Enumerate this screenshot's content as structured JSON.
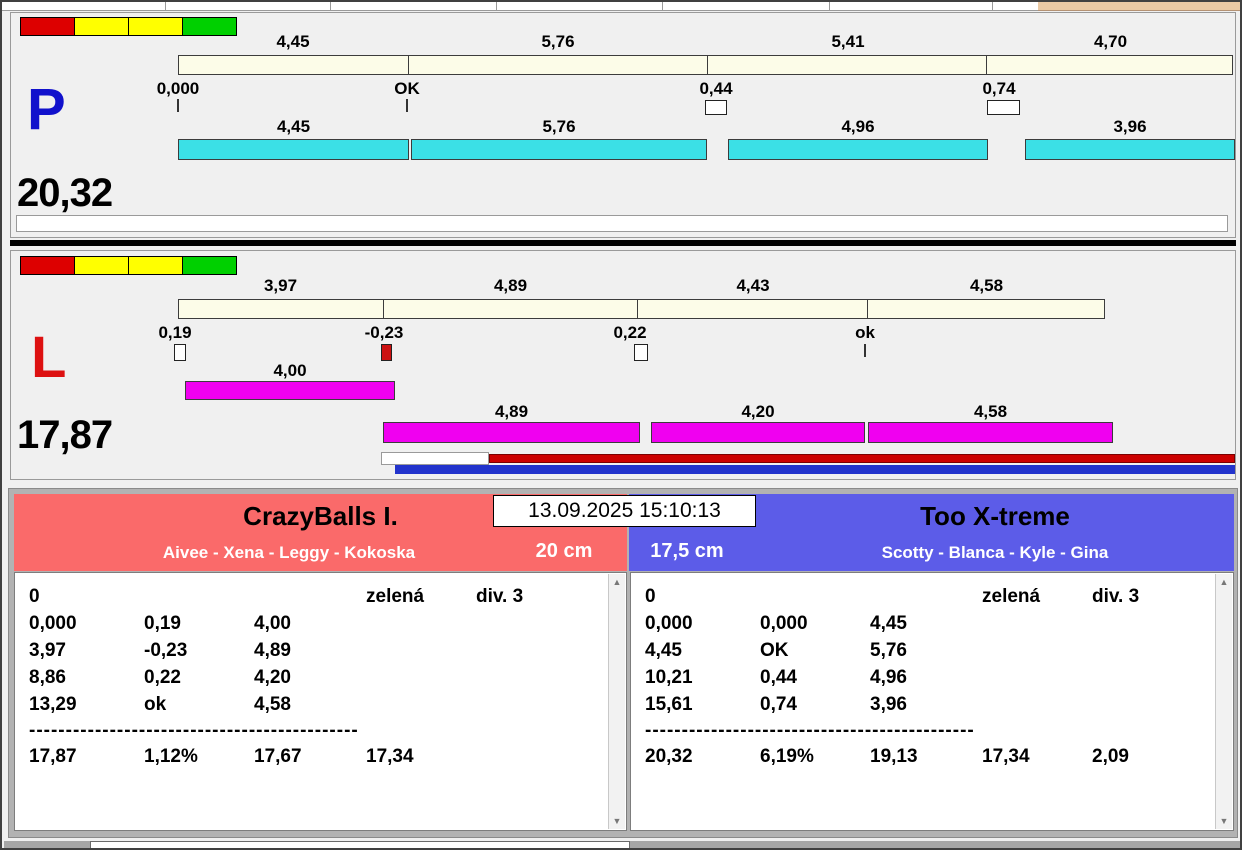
{
  "colors": {
    "cyan_bar": "#3be0e6",
    "magenta_bar": "#f000f0",
    "cream_bar": "#fcfce8",
    "team_left_bg": "#fa6a6a",
    "team_right_bg": "#5c5ce8",
    "p_letter_color": "#1111cc",
    "l_letter_color": "#dd1111",
    "status_red": "#dd0000",
    "status_yellow": "#ffff00",
    "status_green": "#00d000",
    "red_stripe": "#cc0000",
    "blue_stripe": "#2233cc"
  },
  "icons": {
    "scroll_up": "▲",
    "scroll_down": "▼"
  },
  "panel_p": {
    "letter": "P",
    "total": "20,32",
    "segment_labels": [
      "4,45",
      "5,76",
      "5,41",
      "4,70"
    ],
    "marker_labels": [
      "0,000",
      "OK",
      "0,44",
      "0,74"
    ],
    "bar_labels": [
      "4,45",
      "5,76",
      "4,96",
      "3,96"
    ]
  },
  "panel_l": {
    "letter": "L",
    "total": "17,87",
    "segment_labels": [
      "3,97",
      "4,89",
      "4,43",
      "4,58"
    ],
    "marker_labels": [
      "0,19",
      "-0,23",
      "0,22",
      "ok"
    ],
    "first_bar_label": "4,00",
    "bar_labels": [
      "4,89",
      "4,20",
      "4,58"
    ]
  },
  "scoreboard": {
    "datetime": "13.09.2025 15:10:13",
    "left": {
      "team": "CrazyBalls I.",
      "players": "Aivee - Xena - Leggy - Kokoska",
      "distance": "20 cm",
      "rows": [
        [
          "0",
          "",
          "",
          "zelená",
          "div. 3"
        ],
        [
          "0,000",
          "0,19",
          "4,00",
          "",
          ""
        ],
        [
          "3,97",
          "-0,23",
          "4,89",
          "",
          ""
        ],
        [
          "8,86",
          "0,22",
          "4,20",
          "",
          ""
        ],
        [
          "13,29",
          "ok",
          "4,58",
          "",
          ""
        ]
      ],
      "separator": "---------------------------------------------",
      "total_row": [
        "17,87",
        "1,12%",
        "17,67",
        "17,34",
        ""
      ]
    },
    "right": {
      "team": "Too X-treme",
      "players": "Scotty - Blanca - Kyle - Gina",
      "distance": "17,5 cm",
      "rows": [
        [
          "0",
          "",
          "",
          "zelená",
          "div. 3"
        ],
        [
          "0,000",
          "0,000",
          "4,45",
          "",
          ""
        ],
        [
          "4,45",
          "OK",
          "5,76",
          "",
          ""
        ],
        [
          "10,21",
          "0,44",
          "4,96",
          "",
          ""
        ],
        [
          "15,61",
          "0,74",
          "3,96",
          "",
          ""
        ]
      ],
      "separator": "---------------------------------------------",
      "total_row": [
        "20,32",
        "6,19%",
        "19,13",
        "17,34",
        "2,09"
      ]
    }
  }
}
